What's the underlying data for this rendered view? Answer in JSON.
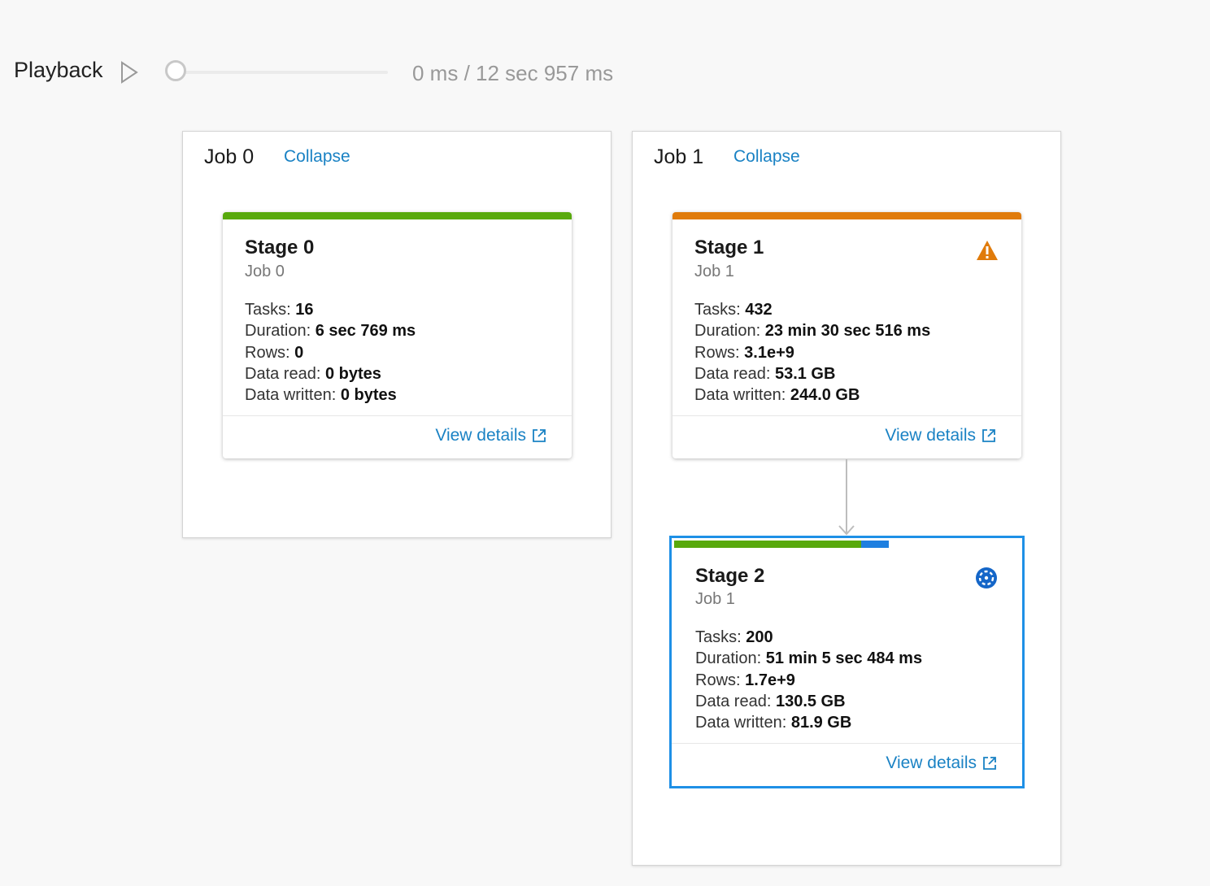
{
  "playback": {
    "label": "Playback",
    "time": "0 ms / 12 sec 957 ms",
    "play_icon": "play-icon",
    "progress": 0
  },
  "jobs": [
    {
      "title": "Job 0",
      "collapse_label": "Collapse",
      "stages": [
        {
          "title": "Stage 0",
          "job": "Job 0",
          "status_color": "#58a90c",
          "stats": [
            {
              "label": "Tasks:",
              "value": "16"
            },
            {
              "label": "Duration:",
              "value": "6 sec 769 ms"
            },
            {
              "label": "Rows:",
              "value": "0"
            },
            {
              "label": "Data read:",
              "value": "0 bytes"
            },
            {
              "label": "Data written:",
              "value": "0 bytes"
            }
          ],
          "view_details_label": "View details"
        }
      ]
    },
    {
      "title": "Job 1",
      "collapse_label": "Collapse",
      "stages": [
        {
          "title": "Stage 1",
          "job": "Job 1",
          "status_color": "#e07b0b",
          "status_icon": "warning-icon",
          "stats": [
            {
              "label": "Tasks:",
              "value": "432"
            },
            {
              "label": "Duration:",
              "value": "23 min 30 sec 516 ms"
            },
            {
              "label": "Rows:",
              "value": "3.1e+9"
            },
            {
              "label": "Data read:",
              "value": "53.1 GB"
            },
            {
              "label": "Data written:",
              "value": "244.0 GB"
            }
          ],
          "view_details_label": "View details"
        },
        {
          "title": "Stage 2",
          "job": "Job 1",
          "status_color": "#58a90c",
          "progress_color": "#1e7fe0",
          "progress": 0.54,
          "running_fraction": 0.08,
          "status_icon": "running-icon",
          "selected": true,
          "stats": [
            {
              "label": "Tasks:",
              "value": "200"
            },
            {
              "label": "Duration:",
              "value": "51 min 5 sec 484 ms"
            },
            {
              "label": "Rows:",
              "value": "1.7e+9"
            },
            {
              "label": "Data read:",
              "value": "130.5 GB"
            },
            {
              "label": "Data written:",
              "value": "81.9 GB"
            }
          ],
          "view_details_label": "View details"
        }
      ]
    }
  ],
  "colors": {
    "link": "#1a82c4",
    "selected_border": "#1e90e6",
    "warning": "#e07b0b"
  }
}
